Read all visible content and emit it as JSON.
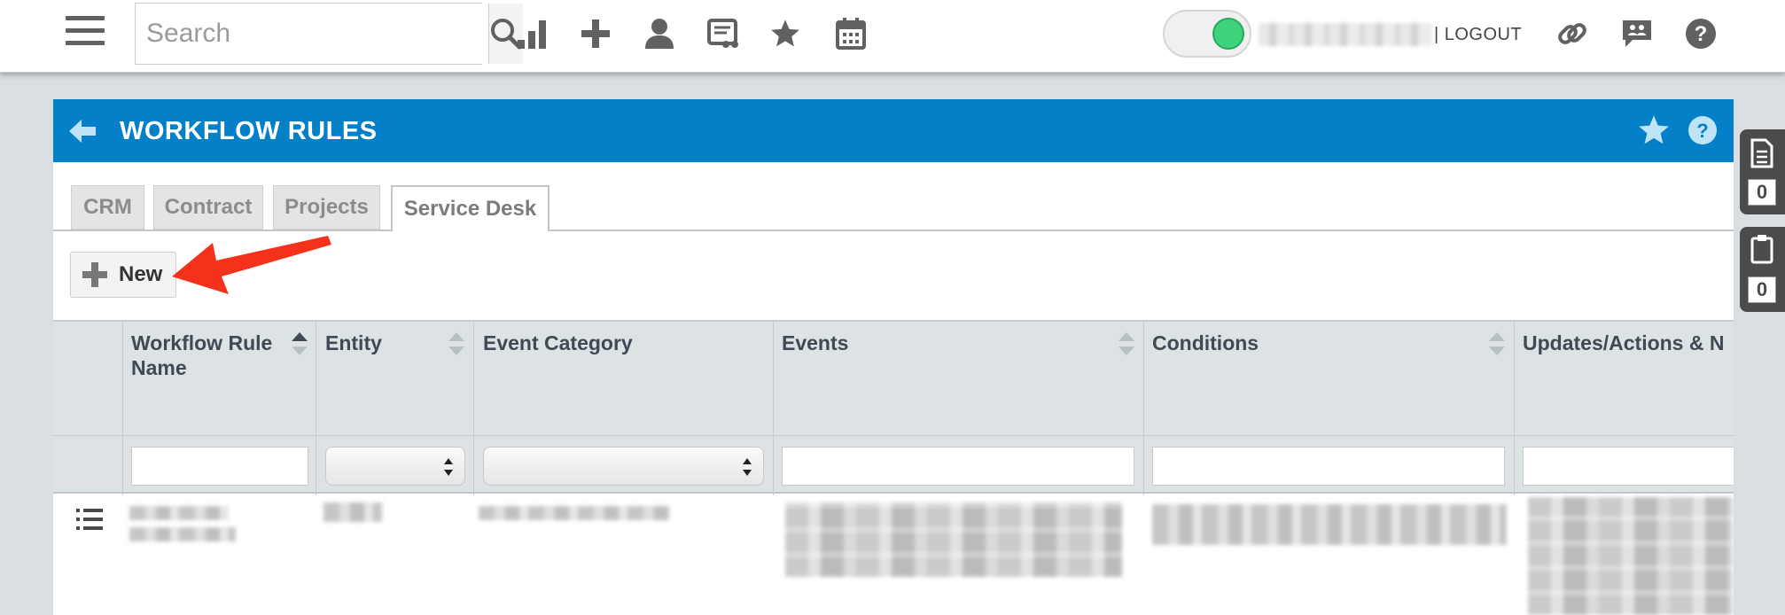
{
  "topbar": {
    "search_placeholder": "Search",
    "icons": [
      "menu-icon",
      "search-icon",
      "reports-icon",
      "add-icon",
      "user-icon",
      "invoice-icon",
      "favorites-icon",
      "calendar-icon",
      "link-icon",
      "chat-icon",
      "help-icon"
    ],
    "logout_label": "| LOGOUT",
    "toggle_color": "#3ed37a"
  },
  "page": {
    "title": "WORKFLOW RULES",
    "header_color": "#0480c8"
  },
  "tabs": [
    {
      "label": "CRM"
    },
    {
      "label": "Contract"
    },
    {
      "label": "Projects"
    },
    {
      "label": "Service Desk",
      "active": true
    }
  ],
  "toolbar": {
    "new_label": "New"
  },
  "grid": {
    "columns": [
      {
        "line1": "Workflow Rule",
        "line2": "Name",
        "sortable": true
      },
      {
        "line1": "Entity",
        "line2": "",
        "sortable": true
      },
      {
        "line1": "Event Category",
        "line2": "",
        "sortable": false
      },
      {
        "line1": "Events",
        "line2": "",
        "sortable": true
      },
      {
        "line1": "Conditions",
        "line2": "",
        "sortable": true
      },
      {
        "line1": "Updates/Actions & N",
        "line2": "",
        "sortable": false
      }
    ]
  },
  "side_badges": [
    {
      "icon": "document-icon",
      "count": "0"
    },
    {
      "icon": "clipboard-icon",
      "count": "0"
    }
  ],
  "annotation": {
    "arrow_color": "#f4321c"
  }
}
